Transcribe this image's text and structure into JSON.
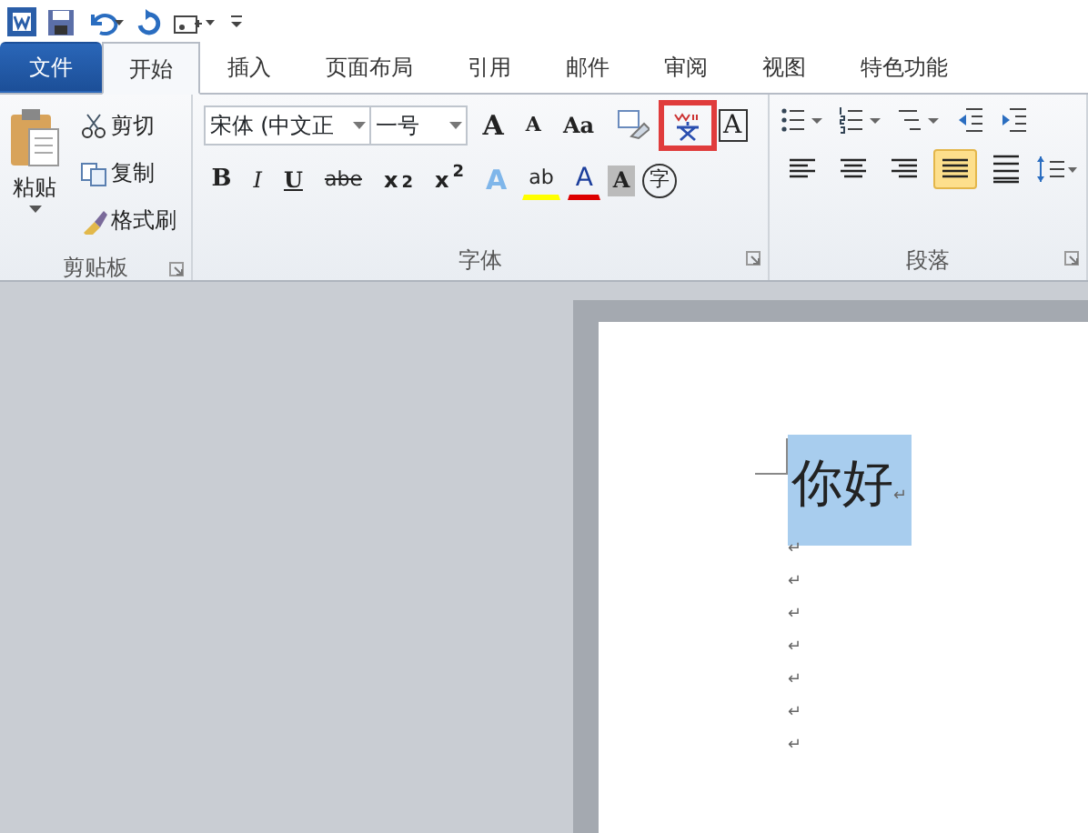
{
  "tabs": [
    {
      "label": "文件",
      "kind": "file",
      "selected": false
    },
    {
      "label": "开始",
      "kind": "tab",
      "selected": true
    },
    {
      "label": "插入",
      "kind": "tab",
      "selected": false
    },
    {
      "label": "页面布局",
      "kind": "tab",
      "selected": false
    },
    {
      "label": "引用",
      "kind": "tab",
      "selected": false
    },
    {
      "label": "邮件",
      "kind": "tab",
      "selected": false
    },
    {
      "label": "审阅",
      "kind": "tab",
      "selected": false
    },
    {
      "label": "视图",
      "kind": "tab",
      "selected": false
    },
    {
      "label": "特色功能",
      "kind": "tab",
      "selected": false
    }
  ],
  "clipboard": {
    "label": "剪贴板",
    "paste": "粘贴",
    "items": [
      {
        "kind": "cut",
        "label": "剪切"
      },
      {
        "kind": "copy",
        "label": "复制"
      },
      {
        "kind": "painter",
        "label": "格式刷"
      }
    ]
  },
  "font": {
    "label": "字体",
    "font_name": "宋体 (中文正",
    "font_size": "一号",
    "row1": [
      {
        "kind": "grow",
        "text": "A"
      },
      {
        "kind": "shrink",
        "text": "A"
      },
      {
        "kind": "case",
        "text": "Aa"
      },
      {
        "kind": "clear"
      },
      {
        "kind": "phonetic",
        "highlighted": true
      },
      {
        "kind": "border",
        "text": "A"
      }
    ],
    "row2": [
      {
        "kind": "bold",
        "text": "B"
      },
      {
        "kind": "italic",
        "text": "I"
      },
      {
        "kind": "underline",
        "text": "U"
      },
      {
        "kind": "strike",
        "text": "abe"
      },
      {
        "kind": "sub",
        "text": "x$_{2}$"
      },
      {
        "kind": "sup",
        "text": "x$^{2}$"
      },
      {
        "kind": "effect",
        "text": "A"
      },
      {
        "kind": "highlight",
        "text": "ab"
      },
      {
        "kind": "color",
        "text": "A"
      },
      {
        "kind": "shade",
        "text": "A"
      },
      {
        "kind": "enclose",
        "text": "字"
      }
    ]
  },
  "paragraph": {
    "label": "段落",
    "row2": [
      {
        "kind": "left",
        "selected": false
      },
      {
        "kind": "center",
        "selected": false
      },
      {
        "kind": "right",
        "selected": false
      },
      {
        "kind": "justify",
        "selected": true
      },
      {
        "kind": "distribute",
        "selected": false
      }
    ]
  },
  "document": {
    "paragraphs": [
      {
        "text": "你好",
        "mark": "↵",
        "selected": true
      },
      {
        "mark": "↵",
        "selected": false
      },
      {
        "mark": "↵",
        "selected": false
      },
      {
        "mark": "↵",
        "selected": false
      },
      {
        "mark": "↵",
        "selected": false
      },
      {
        "mark": "↵",
        "selected": false
      },
      {
        "mark": "↵",
        "selected": false
      },
      {
        "mark": "↵",
        "selected": false
      }
    ]
  }
}
